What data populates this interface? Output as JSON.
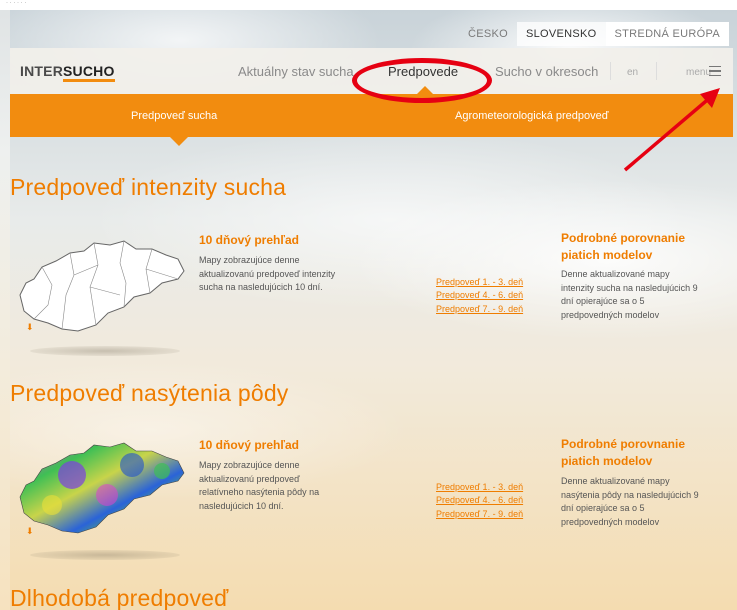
{
  "top_strip": {
    "text": "· · · · · ·"
  },
  "country_tabs": [
    "ČESKO",
    "SLOVENSKO",
    "STREDNÁ EURÓPA"
  ],
  "navbar": {
    "logo_prefix": "INTER",
    "logo_bold": "SUCHO",
    "items": [
      "Aktuálny stav sucha",
      "Predpovede",
      "Sucho v okresoch"
    ],
    "lang": "en",
    "menu_label": "menu"
  },
  "subtabs": [
    "Predpoveď sucha",
    "Agrometeorologická predpoveď"
  ],
  "section1": {
    "title": "Predpoveď intenzity sucha",
    "left_heading": "10 dňový prehľad",
    "left_desc": [
      "Mapy zobrazujúce denne",
      "aktualizovanú predpoveď intenzity",
      "sucha na nasledujúcich 10 dní."
    ],
    "links": [
      "Predpoveď 1. - 3. deň",
      "Predpoveď 4. - 6. deň",
      "Predpoveď 7. - 9. deň"
    ],
    "right_heading": [
      "Podrobné porovnanie",
      "piatich modelov"
    ],
    "right_desc": [
      "Denne aktualizované mapy",
      "intenzity sucha na nasledujúcich 9",
      "dní opierajúce sa o 5",
      "predpovedných modelov"
    ]
  },
  "section2": {
    "title": "Predpoveď nasýtenia pôdy",
    "left_heading": "10 dňový prehľad",
    "left_desc": [
      "Mapy zobrazujúce denne",
      "aktualizovanú predpoveď",
      "relatívneho nasýtenia pôdy na",
      "nasledujúcich 10 dní."
    ],
    "links": [
      "Predpoveď 1. - 3. deň",
      "Predpoveď 4. - 6. deň",
      "Predpoveď 7. - 9. deň"
    ],
    "right_heading": [
      "Podrobné porovnanie",
      "piatich modelov"
    ],
    "right_desc": [
      "Denne aktualizované mapy",
      "nasýtenia pôdy na nasledujúcich 9",
      "dní opierajúce sa o 5",
      "predpovedných modelov"
    ]
  },
  "section3": {
    "title": "Dlhodobá predpoveď"
  },
  "icons": {
    "menu": "hamburger-icon",
    "download": "download-icon",
    "map1": "slovakia-outline-map",
    "map2": "slovakia-soil-moisture-map"
  },
  "colors": {
    "accent": "#f28c0f",
    "annotation": "#e60012"
  }
}
